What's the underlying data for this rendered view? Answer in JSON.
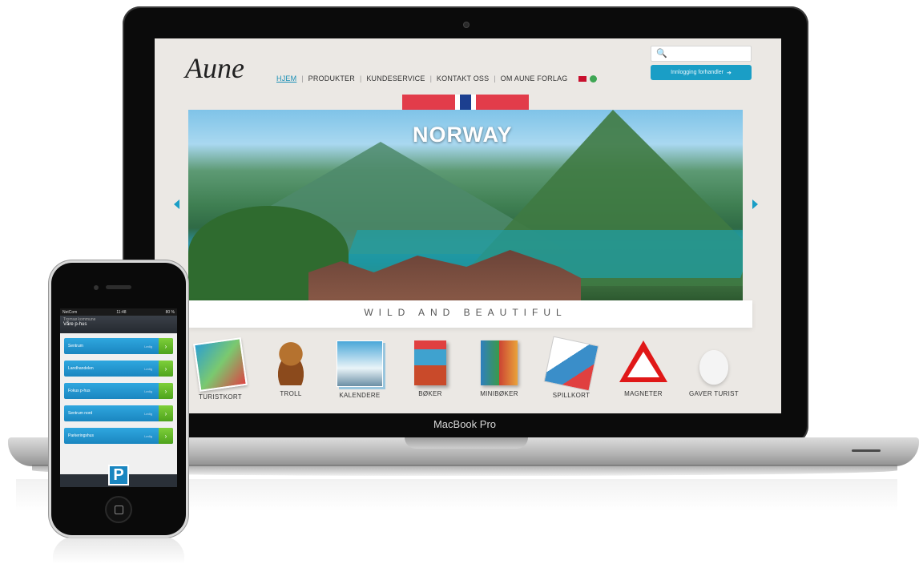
{
  "laptop": {
    "label": "MacBook Pro"
  },
  "site": {
    "logo": "Aune",
    "nav": [
      "HJEM",
      "PRODUKTER",
      "KUNDESERVICE",
      "KONTAKT OSS",
      "OM AUNE FORLAG"
    ],
    "search_icon": "🔍",
    "login_label": "Innlogging forhandler"
  },
  "hero": {
    "title": "NORWAY",
    "caption": "WILD AND BEAUTIFUL"
  },
  "products": [
    "TURISTKORT",
    "TROLL",
    "KALENDERE",
    "BØKER",
    "MINIBØKER",
    "SPILLKORT",
    "MAGNETER",
    "GAVER TURIST"
  ],
  "phone": {
    "status_left": "NetCom",
    "status_time": "11:48",
    "status_right": "80 %",
    "header_title": "Tromsø kommune",
    "header_sub": "Våre p-hus",
    "items": [
      {
        "name": "Sentrum",
        "dist": "Ledig"
      },
      {
        "name": "Landhandelen",
        "dist": "Ledig"
      },
      {
        "name": "Fokus p-hus",
        "dist": "Ledig"
      },
      {
        "name": "Sentrum nord",
        "dist": "Ledig"
      },
      {
        "name": "Parkeringshus",
        "dist": "Ledig"
      }
    ],
    "p_icon": "P",
    "go_icon": "›"
  }
}
